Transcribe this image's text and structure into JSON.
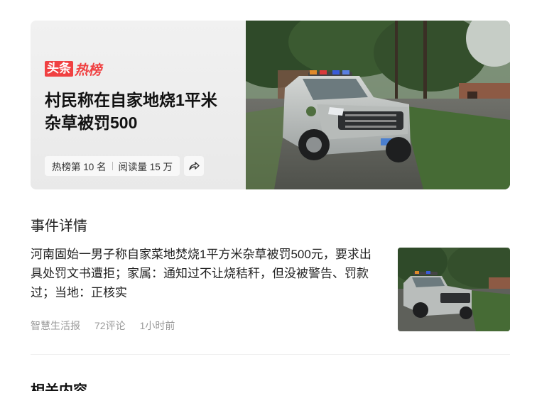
{
  "card": {
    "brand_box": "头条",
    "brand_text": "热榜",
    "headline": "村民称在自家地烧1平米杂草被罚500",
    "rank": "热榜第 10 名",
    "reads": "阅读量 15 万",
    "share_icon": "share-arrow-icon"
  },
  "section": {
    "title": "事件详情"
  },
  "event": {
    "summary": "河南固始一男子称自家菜地焚烧1平方米杂草被罚500元，要求出具处罚文书遭拒；家属：通知过不让烧秸秆，但没被警告、罚款过；当地：正核实",
    "source": "智慧生活报",
    "comments": "72评论",
    "time": "1小时前"
  },
  "next_section": {
    "title": "相关内容"
  },
  "colors": {
    "brand_red": "#f04142",
    "meta_gray": "#999999"
  }
}
